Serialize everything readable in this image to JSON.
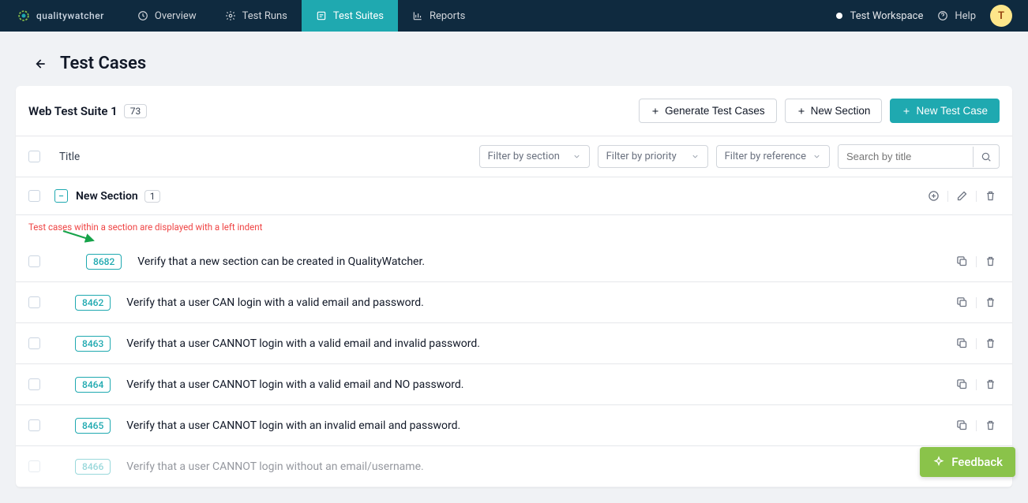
{
  "brand": {
    "name": "qualitywatcher"
  },
  "nav": {
    "items": [
      {
        "label": "Overview"
      },
      {
        "label": "Test Runs"
      },
      {
        "label": "Test Suites"
      },
      {
        "label": "Reports"
      }
    ],
    "workspace": "Test Workspace",
    "help": "Help",
    "avatar_initial": "T"
  },
  "page_title": "Test Cases",
  "suite": {
    "name": "Web Test Suite 1",
    "count": "73"
  },
  "buttons": {
    "generate": "Generate Test Cases",
    "new_section": "New Section",
    "new_case": "New Test Case"
  },
  "columns": {
    "title": "Title"
  },
  "filters": {
    "section": "Filter by section",
    "priority": "Filter by priority",
    "reference": "Filter by reference",
    "search_placeholder": "Search by title"
  },
  "section": {
    "name": "New Section",
    "count": "1"
  },
  "annotation": "Test cases within a section are displayed with a left indent",
  "cases": [
    {
      "id": "8682",
      "title": "Verify that a new section can be created in QualityWatcher."
    },
    {
      "id": "8462",
      "title": "Verify that a user CAN login with a valid email and password."
    },
    {
      "id": "8463",
      "title": "Verify that a user CANNOT login with a valid email and invalid password."
    },
    {
      "id": "8464",
      "title": "Verify that a user CANNOT login with a valid email and NO password."
    },
    {
      "id": "8465",
      "title": "Verify that a user CANNOT login with an invalid email and password."
    },
    {
      "id": "8466",
      "title": "Verify that a user CANNOT login without an email/username."
    }
  ],
  "feedback": "Feedback"
}
